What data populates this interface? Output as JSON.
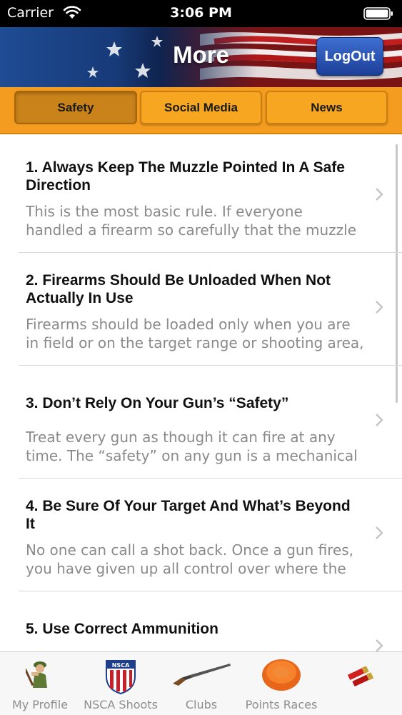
{
  "status_bar": {
    "carrier": "Carrier",
    "time": "3:06 PM"
  },
  "header": {
    "title": "More",
    "logout_label": "LogOut"
  },
  "tabs": [
    {
      "label": "Safety",
      "active": true
    },
    {
      "label": "Social Media",
      "active": false
    },
    {
      "label": "News",
      "active": false
    }
  ],
  "rules": [
    {
      "title": "1. Always Keep The Muzzle Pointed In A Safe Direction",
      "desc_lines": [
        "This is the most basic rule. If everyone",
        "handled a firearm so carefully that the muzzle"
      ]
    },
    {
      "title": "2. Firearms Should Be Unloaded When Not Actually In Use",
      "desc_lines": [
        "Firearms should be loaded only when you are",
        "in field or on the target range or shooting area,"
      ]
    },
    {
      "title": "3. Don’t Rely On Your Gun’s “Safety”",
      "desc_lines": [
        "Treat every gun as though it can fire at any",
        "time. The “safety” on any gun is a mechanical"
      ]
    },
    {
      "title": "4. Be Sure Of Your Target And What’s Beyond It",
      "desc_lines": [
        "No one can call a shot back. Once a gun fires,",
        "you have given up all control over where the"
      ]
    },
    {
      "title": "5. Use Correct Ammunition",
      "desc_lines": [
        "",
        ""
      ]
    }
  ],
  "bottom_tabs": [
    {
      "label": "My Profile",
      "icon": "hunter-icon"
    },
    {
      "label": "NSCA Shoots",
      "icon": "nsca-shield-icon",
      "badge_text": "NSCA"
    },
    {
      "label": "Clubs",
      "icon": "shotgun-icon"
    },
    {
      "label": "Points Races",
      "icon": "clay-target-icon"
    },
    {
      "label": "",
      "icon": "shotgun-shells-icon"
    }
  ],
  "colors": {
    "orange": "#f39c1f",
    "active_tab": "#c9831a",
    "logout_blue": "#2a52b8"
  }
}
